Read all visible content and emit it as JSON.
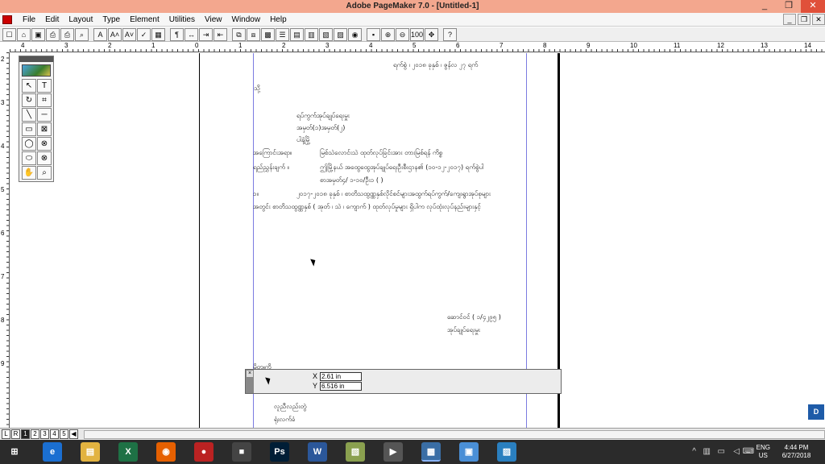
{
  "window": {
    "title": "Adobe PageMaker 7.0 - [Untitled-1]",
    "controls": [
      "_",
      "❒",
      "✕"
    ],
    "mdi_controls": [
      "_",
      "❒",
      "✕"
    ]
  },
  "menu": [
    "File",
    "Edit",
    "Layout",
    "Type",
    "Element",
    "Utilities",
    "View",
    "Window",
    "Help"
  ],
  "toolbar": {
    "buttons": [
      "☐",
      "⌂",
      "▣",
      "⎙",
      "⎙",
      "⌕",
      "A",
      "A˄",
      "A˅",
      "✓",
      "▦",
      "¶",
      "↔",
      "⇥",
      "⇤",
      "⧉",
      "⧈",
      "▩",
      "☰",
      "▤",
      "▥",
      "▧",
      "▨",
      "◉",
      "▪",
      "⊕",
      "⊖",
      "100",
      "✥",
      "?"
    ]
  },
  "ruler": {
    "h_labels": [
      "4",
      "3",
      "2",
      "1",
      "0",
      "1",
      "2",
      "3",
      "4",
      "5",
      "6",
      "7",
      "8",
      "9",
      "10",
      "11",
      "12",
      "13",
      "14"
    ],
    "v_labels": [
      "2",
      "3",
      "4",
      "5",
      "6",
      "7",
      "8",
      "9"
    ]
  },
  "toolbox": {
    "tools": [
      "↖",
      "T",
      "↻",
      "⌗",
      "╲",
      "─",
      "▭",
      "⊠",
      "◯",
      "⊗",
      "⬭",
      "⊗",
      "✋",
      "⌕"
    ]
  },
  "document": {
    "lines": [
      "ရက်စွဲ ၊ ၂၀၁၈ ခုနှစ် ၊ ဇွန်လ ၂၇ ရက်",
      "သို့",
      "ရပ်ကွက်အုပ်ချုပ်ရေးမှူး",
      "အမှတ်(၁)အမှတ်(၂)",
      "ပါနံ့မြို့",
      "အကြောင်းအရာ။",
      "မြစ်သဲလောင်းသဲ ထုတ်လုပ်ခြင်းအား တားမြစ်ရန် ကိစ္စ",
      "ရည်ညွှန်းချက် ။",
      "ဤမြို့နယ် အထွေထွေအုပ်ချုပ်ရေးဦးစီးဌာန၏ (၁၀-၁၂-၂၀၁၇) ရက်စွဲပါ",
      "စာအမှတ်၄/ ၁-၁၀/ဦး၁ (   )",
      "၁။",
      "၂၀၁၇-၂၀၁၈ ခုနှစ် ၊ စာတိသထွဏ္ဏနှစ်လိုင်စင်များအထွက်ရပ်ကွက်/ကျေးရွာအုပ်စုများ",
      "အတွင်း စာတိသထွဏ္ဏနှစ် ( အုတ် ၊ သဲ ၊ ကျောက် ) ထုတ်လုပ်မှုများ ရှိပါက လုပ်ထုံးလုပ်နည်းများနှင့်",
      "ဆောင်ဝင် ( ၁/၄၂၉၅ )",
      "အုပ်ချုပ်ရေးမှူး",
      "မိတ္တူကို",
      "လူညီလည်းတွဲ",
      "ရုံးလက်ခံ"
    ]
  },
  "palette": {
    "x_label": "X",
    "y_label": "Y",
    "x_value": "2.61 in",
    "y_value": "6.516 in"
  },
  "pages": {
    "tabs": [
      "L",
      "R",
      "1",
      "2",
      "3",
      "4",
      "5",
      "◀"
    ],
    "active_index": 2
  },
  "taskbar": {
    "apps": [
      {
        "name": "windows-start",
        "glyph": "⊞",
        "color": "#2b2b2b"
      },
      {
        "name": "internet-explorer",
        "glyph": "e",
        "color": "#1b6fd1"
      },
      {
        "name": "file-explorer",
        "glyph": "▤",
        "color": "#e2b340"
      },
      {
        "name": "excel",
        "glyph": "X",
        "color": "#1e7145"
      },
      {
        "name": "firefox",
        "glyph": "◉",
        "color": "#e66000"
      },
      {
        "name": "media",
        "glyph": "●",
        "color": "#b22"
      },
      {
        "name": "camera",
        "glyph": "■",
        "color": "#444"
      },
      {
        "name": "photoshop",
        "glyph": "Ps",
        "color": "#001e36"
      },
      {
        "name": "word",
        "glyph": "W",
        "color": "#2b579a"
      },
      {
        "name": "notes",
        "glyph": "▧",
        "color": "#8aa04f"
      },
      {
        "name": "video",
        "glyph": "▶",
        "color": "#555"
      },
      {
        "name": "pagemaker",
        "glyph": "▩",
        "color": "#3a6ea5"
      },
      {
        "name": "remote",
        "glyph": "▣",
        "color": "#4a8fd6"
      },
      {
        "name": "photos",
        "glyph": "▨",
        "color": "#2a7fbf"
      }
    ],
    "tray": {
      "lang_top": "ENG",
      "lang_bottom": "US",
      "time": "4:44 PM",
      "date": "6/27/2018"
    }
  },
  "overlay_badge": "D"
}
